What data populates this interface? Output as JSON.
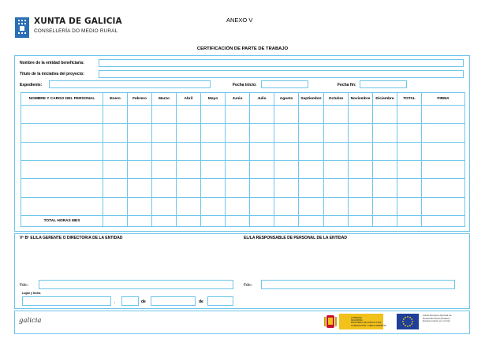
{
  "header": {
    "brand": "XUNTA DE GALICIA",
    "department": "CONSELLERÍA DO MEDIO RURAL",
    "annex": "ANEXO V",
    "title": "CERTIFICACIÓN DE PARTE DE TRABAJO"
  },
  "form": {
    "entity_label": "Nombre de la entidad beneficiaria:",
    "entity_value": "",
    "project_label": "Título de la iniciativa del proyecto:",
    "project_value": "",
    "file_label": "Expediente:",
    "file_value": "",
    "start_label": "Fecha inicio:",
    "start_value": "",
    "end_label": "Fecha fin:",
    "end_value": ""
  },
  "table": {
    "columns": [
      "NOMBRE Y CARGO DEL PERSONAL",
      "Enero",
      "Febrero",
      "Marzo",
      "Abril",
      "Mayo",
      "Junio",
      "Julio",
      "Agosto",
      "Septiembre",
      "Octubre",
      "Noviembre",
      "Diciembre",
      "TOTAL",
      "FIRMA"
    ],
    "row_count": 6,
    "total_label": "TOTAL HORAS MES"
  },
  "signatures": {
    "left_heading": "Vº Bº EL/LA GERENTE O DIRECTOR/A DE LA ENTIDAD",
    "right_heading": "EL/LA RESPONSABLE DE PERSONAL DE LA ENTIDAD",
    "fdo_left": "Fdo.:",
    "fdo_right": "Fdo.:",
    "place_date_label": "Lugar y fecha",
    "comma": ",",
    "de1": "de",
    "de2": "de"
  },
  "footer": {
    "galicia_logo": "galicia",
    "gov_text": [
      "GOBIERNO",
      "DE ESPAÑA",
      "MINISTERIO DE AGRICULTURA,",
      "ALIMENTACIÓN Y MEDIO AMBIENTE"
    ],
    "eu_text": [
      "Fondo Europeo Agrícola de",
      "Desarrollo Rural (Feader):",
      "Europa invierte en el rural"
    ]
  },
  "colors": {
    "frame": "#6ec6ea",
    "xunta_blue": "#2a6fb6"
  }
}
